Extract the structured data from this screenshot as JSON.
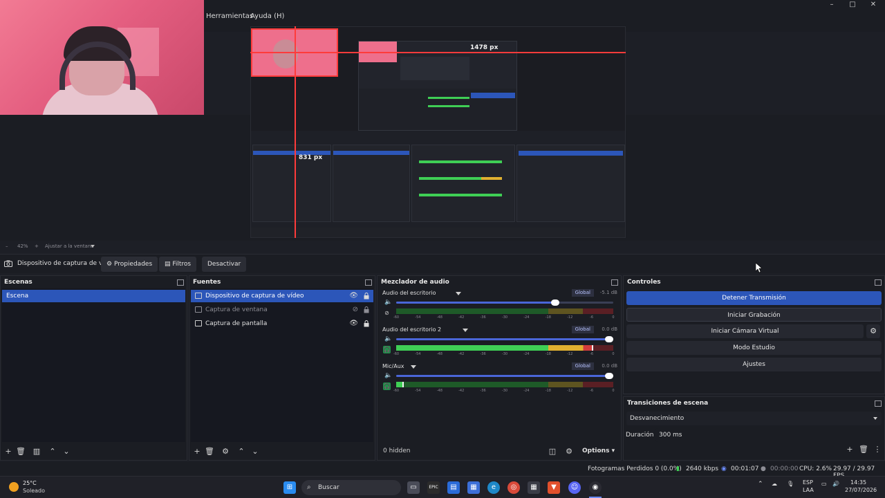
{
  "menu": {
    "tools": "Herramientas",
    "help": "Ayuda (H)"
  },
  "window_controls": {
    "minimize": "–",
    "maximize": "□",
    "close": "✕"
  },
  "preview": {
    "guide_horizontal": "1478 px",
    "guide_vertical": "831 px",
    "zoom_minus": "–",
    "zoom_level": "42%",
    "zoom_plus": "+",
    "zoom_mode": "Ajustar a la ventana"
  },
  "source_toolbar": {
    "selected_source": "Dispositivo de captura de v",
    "properties": "Propiedades",
    "filters": "Filtros",
    "deactivate": "Desactivar"
  },
  "scenes": {
    "title": "Escenas",
    "items": [
      "Escena"
    ]
  },
  "sources": {
    "title": "Fuentes",
    "items": [
      {
        "label": "Dispositivo de captura de vídeo",
        "visible": true,
        "selected": true
      },
      {
        "label": "Captura de ventana",
        "visible": false,
        "selected": false
      },
      {
        "label": "Captura de pantalla",
        "visible": true,
        "selected": false
      }
    ]
  },
  "mixer": {
    "title": "Mezclador de audio",
    "global_label": "Global",
    "scale_labels": [
      "-60",
      "-54",
      "-48",
      "-42",
      "-36",
      "-30",
      "-24",
      "-18",
      "-12",
      "-6",
      "0"
    ],
    "tracks": [
      {
        "name": "Audio del escritorio",
        "db": "-5.1 dB",
        "volume": 0.75,
        "level": 0,
        "monitor": false
      },
      {
        "name": "Audio del escritorio 2",
        "db": "0.0 dB",
        "volume": 1.0,
        "level": 0.9,
        "monitor": true
      },
      {
        "name": "Mic/Aux",
        "db": "0.0 dB",
        "volume": 1.0,
        "level": 0.03,
        "monitor": true
      }
    ],
    "hidden": "0 hidden",
    "options": "Options"
  },
  "controls": {
    "title": "Controles",
    "stop_stream": "Detener Transmisión",
    "start_recording": "Iniciar Grabación",
    "start_virtual_cam": "Iniciar Cámara Virtual",
    "studio_mode": "Modo Estudio",
    "settings": "Ajustes"
  },
  "transitions": {
    "title": "Transiciones de escena",
    "selected": "Desvanecimiento",
    "duration_label": "Duración",
    "duration_value": "300 ms"
  },
  "status": {
    "dropped_frames": "Fotogramas Perdidos 0 (0.0%)",
    "bitrate": "2640 kbps",
    "stream_time": "00:01:07",
    "record_time": "00:00:00",
    "cpu": "CPU: 2.6%",
    "fps": "29.97 / 29.97 FPS"
  },
  "taskbar": {
    "weather_temp": "25°C",
    "weather_desc": "Soleado",
    "search_placeholder": "Buscar",
    "lang_top": "ESP",
    "lang_bottom": "LAA",
    "time": "14:35",
    "date": "27/07/2026"
  },
  "colors": {
    "accent": "#2c56b9",
    "guide": "#ff3b3b",
    "meter_green": "#3fcf55",
    "meter_yellow": "#e0b030",
    "meter_red": "#d23c3c"
  }
}
